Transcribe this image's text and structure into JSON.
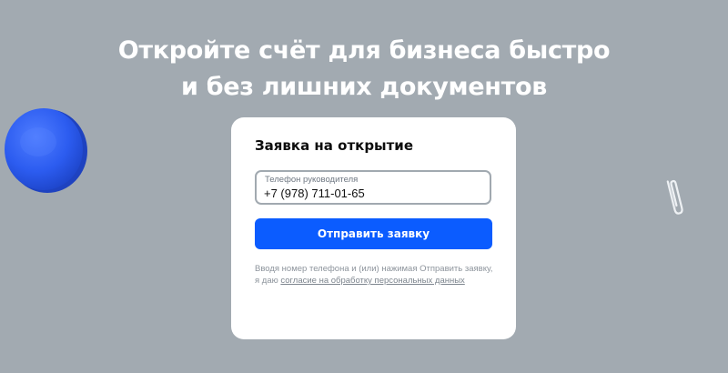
{
  "hero": {
    "title_line1": "Откройте счёт для бизнеса быстро",
    "title_line2": "и без лишних документов"
  },
  "form": {
    "title": "Заявка на открытие",
    "phone_label": "Телефон руководителя",
    "phone_value": "+7 (978) 711-01-65",
    "submit_label": "Отправить заявку",
    "consent_prefix": "Вводя номер телефона и (или) нажимая Отправить заявку, я даю ",
    "consent_link": "согласие на обработку персональных данных"
  },
  "colors": {
    "background": "#a2aab1",
    "accent": "#0b5cff",
    "card": "#ffffff"
  },
  "icons": {
    "coin": "blue-coin-decoration",
    "clip": "paperclip-decoration"
  }
}
